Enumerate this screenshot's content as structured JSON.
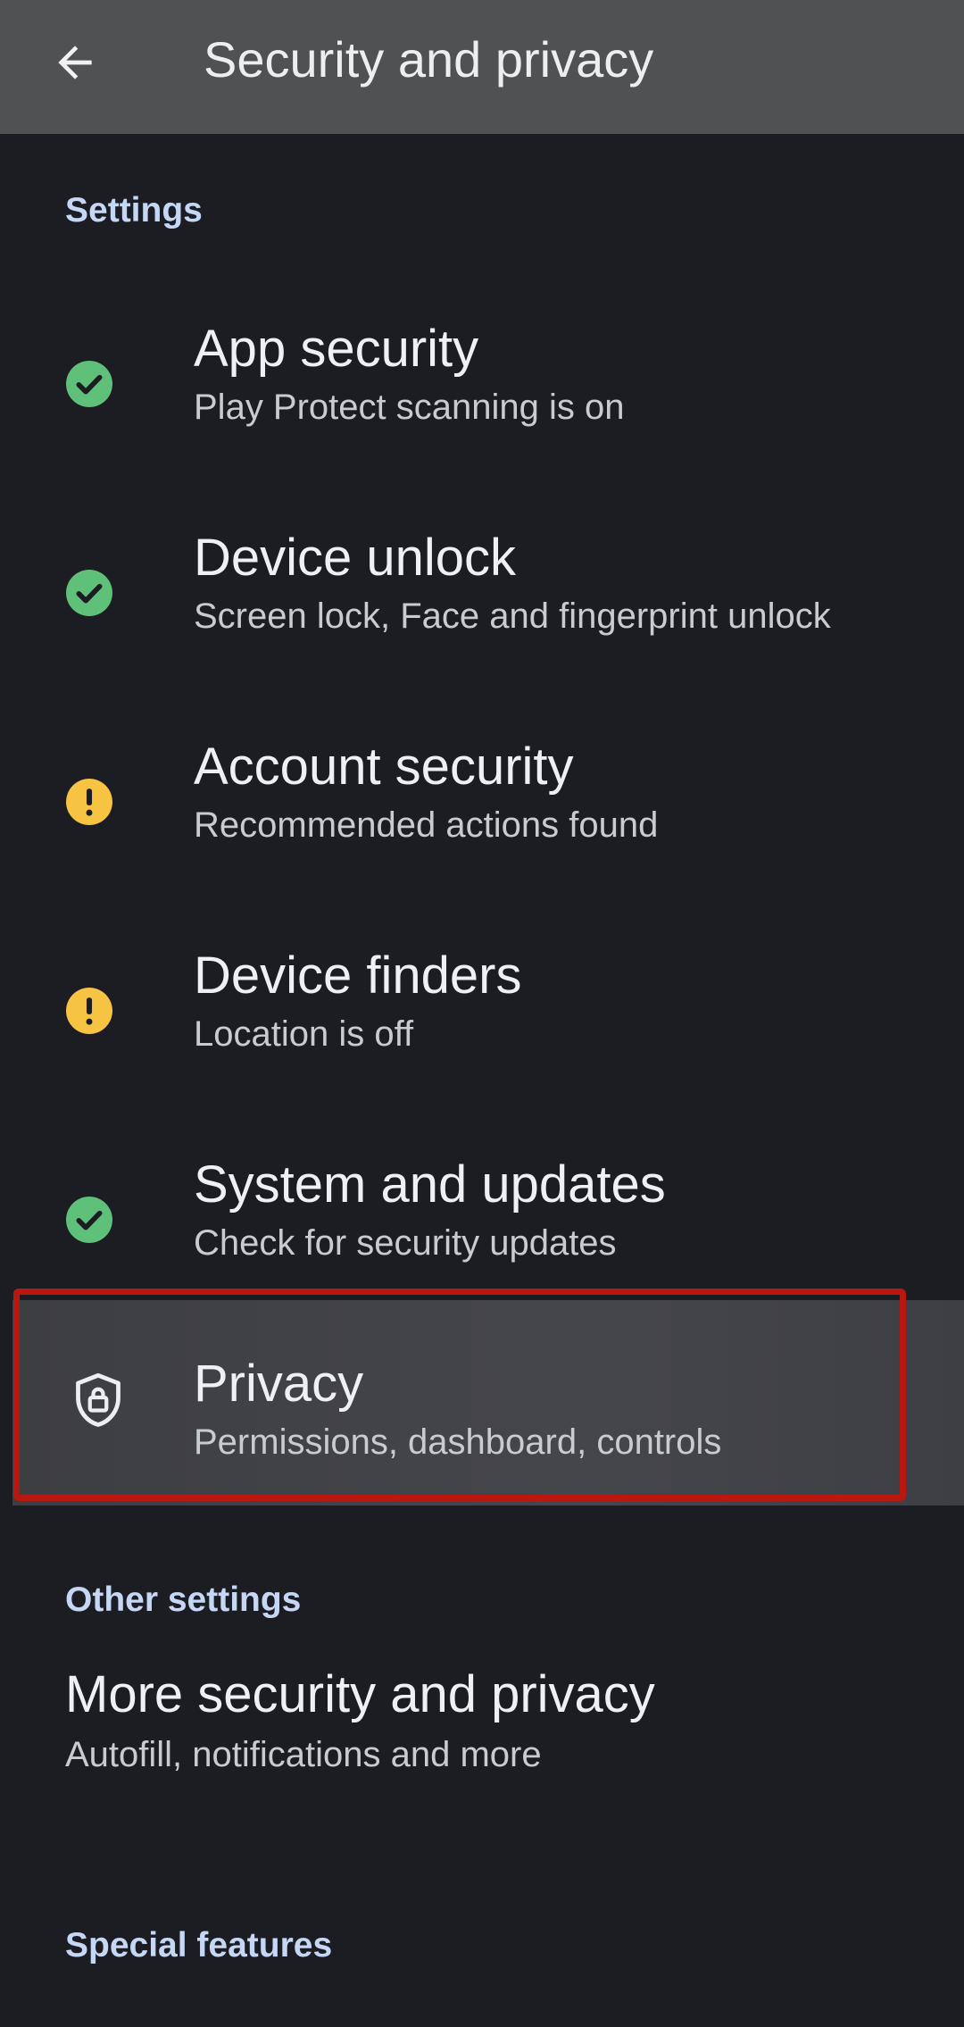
{
  "appbar": {
    "title": "Security and privacy",
    "back_icon": "arrow-back-icon"
  },
  "sections": {
    "settings_header": "Settings",
    "other_header": "Other settings",
    "special_header": "Special features"
  },
  "items": [
    {
      "title": "App security",
      "subtitle": "Play Protect scanning is on",
      "status": "ok",
      "icon": "check-circle-icon"
    },
    {
      "title": "Device unlock",
      "subtitle": "Screen lock, Face and fingerprint unlock",
      "status": "ok",
      "icon": "check-circle-icon"
    },
    {
      "title": "Account security",
      "subtitle": "Recommended actions found",
      "status": "warning",
      "icon": "warning-circle-icon"
    },
    {
      "title": "Device finders",
      "subtitle": "Location is off",
      "status": "warning",
      "icon": "warning-circle-icon"
    },
    {
      "title": "System and updates",
      "subtitle": "Check for security updates",
      "status": "ok",
      "icon": "check-circle-icon"
    }
  ],
  "privacy": {
    "title": "Privacy",
    "subtitle": "Permissions, dashboard, controls",
    "icon": "shield-lock-icon"
  },
  "more": {
    "title": "More security and privacy",
    "subtitle": "Autofill, notifications and more"
  },
  "colors": {
    "ok": "#5fc07a",
    "warning": "#f6c342",
    "accent_header": "#c5d7f5",
    "highlight": "#b8180f"
  }
}
